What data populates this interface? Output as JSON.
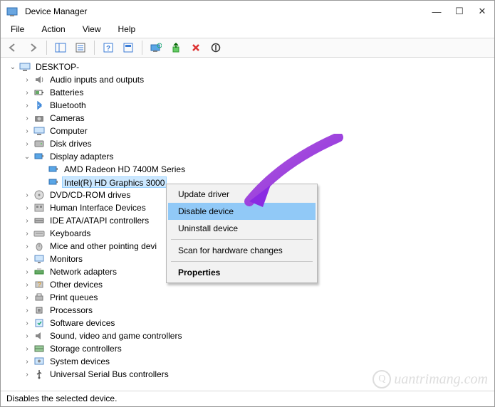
{
  "window": {
    "title": "Device Manager"
  },
  "menu": {
    "file": "File",
    "action": "Action",
    "view": "View",
    "help": "Help"
  },
  "tree": {
    "root": "DESKTOP-",
    "items": {
      "audio": "Audio inputs and outputs",
      "batteries": "Batteries",
      "bluetooth": "Bluetooth",
      "cameras": "Cameras",
      "computer": "Computer",
      "disk": "Disk drives",
      "display": "Display adapters",
      "display_children": {
        "amd": "AMD Radeon HD 7400M Series",
        "intel": "Intel(R) HD Graphics 3000"
      },
      "dvd": "DVD/CD-ROM drives",
      "hid": "Human Interface Devices",
      "ide": "IDE ATA/ATAPI controllers",
      "keyboards": "Keyboards",
      "mice": "Mice and other pointing devi",
      "monitors": "Monitors",
      "network": "Network adapters",
      "other": "Other devices",
      "print": "Print queues",
      "processors": "Processors",
      "software": "Software devices",
      "sound": "Sound, video and game controllers",
      "storage": "Storage controllers",
      "system": "System devices",
      "usb": "Universal Serial Bus controllers"
    }
  },
  "context_menu": {
    "update": "Update driver",
    "disable": "Disable device",
    "uninstall": "Uninstall device",
    "scan": "Scan for hardware changes",
    "properties": "Properties"
  },
  "statusbar": "Disables the selected device.",
  "watermark": "uantrimang.com"
}
